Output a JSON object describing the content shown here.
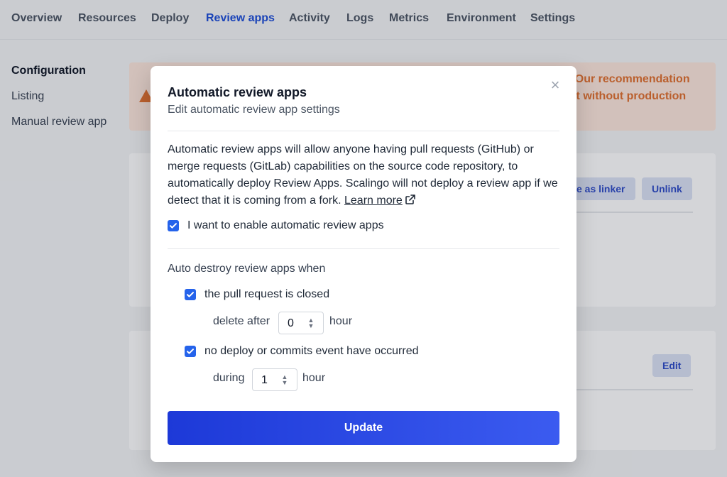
{
  "nav": {
    "tabs": [
      {
        "label": "Overview"
      },
      {
        "label": "Resources"
      },
      {
        "label": "Deploy"
      },
      {
        "label": "Review apps",
        "active": true
      },
      {
        "label": "Activity"
      },
      {
        "label": "Logs"
      },
      {
        "label": "Metrics"
      },
      {
        "label": "Environment"
      },
      {
        "label": "Settings"
      }
    ]
  },
  "sidebar": {
    "items": [
      {
        "label": "Configuration",
        "active": true
      },
      {
        "label": "Listing"
      },
      {
        "label": "Manual review app"
      }
    ]
  },
  "alert": {
    "line1": "s. Our recommendation",
    "line2": "out without production"
  },
  "cards": {
    "linker_button": "e as linker",
    "unlink_button": "Unlink",
    "edit_button": "Edit"
  },
  "modal": {
    "title": "Automatic review apps",
    "subtitle": "Edit automatic review app settings",
    "description": "Automatic review apps will allow anyone having pull requests (GitHub) or merge requests (GitLab) capabilities on the source code repository, to automatically deploy Review Apps. Scalingo will not deploy a review app if we detect that it is coming from a fork.",
    "learn_more": "Learn more",
    "enable_label": "I want to enable automatic review apps",
    "enable_checked": true,
    "auto_destroy_label": "Auto destroy review apps when",
    "pr_closed_label": "the pull request is closed",
    "pr_closed_checked": true,
    "delete_after_label": "delete after",
    "delete_after_value": "0",
    "delete_after_unit": "hour",
    "no_deploy_label": "no deploy or commits event have occurred",
    "no_deploy_checked": true,
    "during_label": "during",
    "during_value": "1",
    "during_unit": "hour",
    "update_button": "Update"
  },
  "colors": {
    "accent": "#2563eb",
    "nav_active": "#1d4ed8",
    "warning": "#e0702f"
  }
}
